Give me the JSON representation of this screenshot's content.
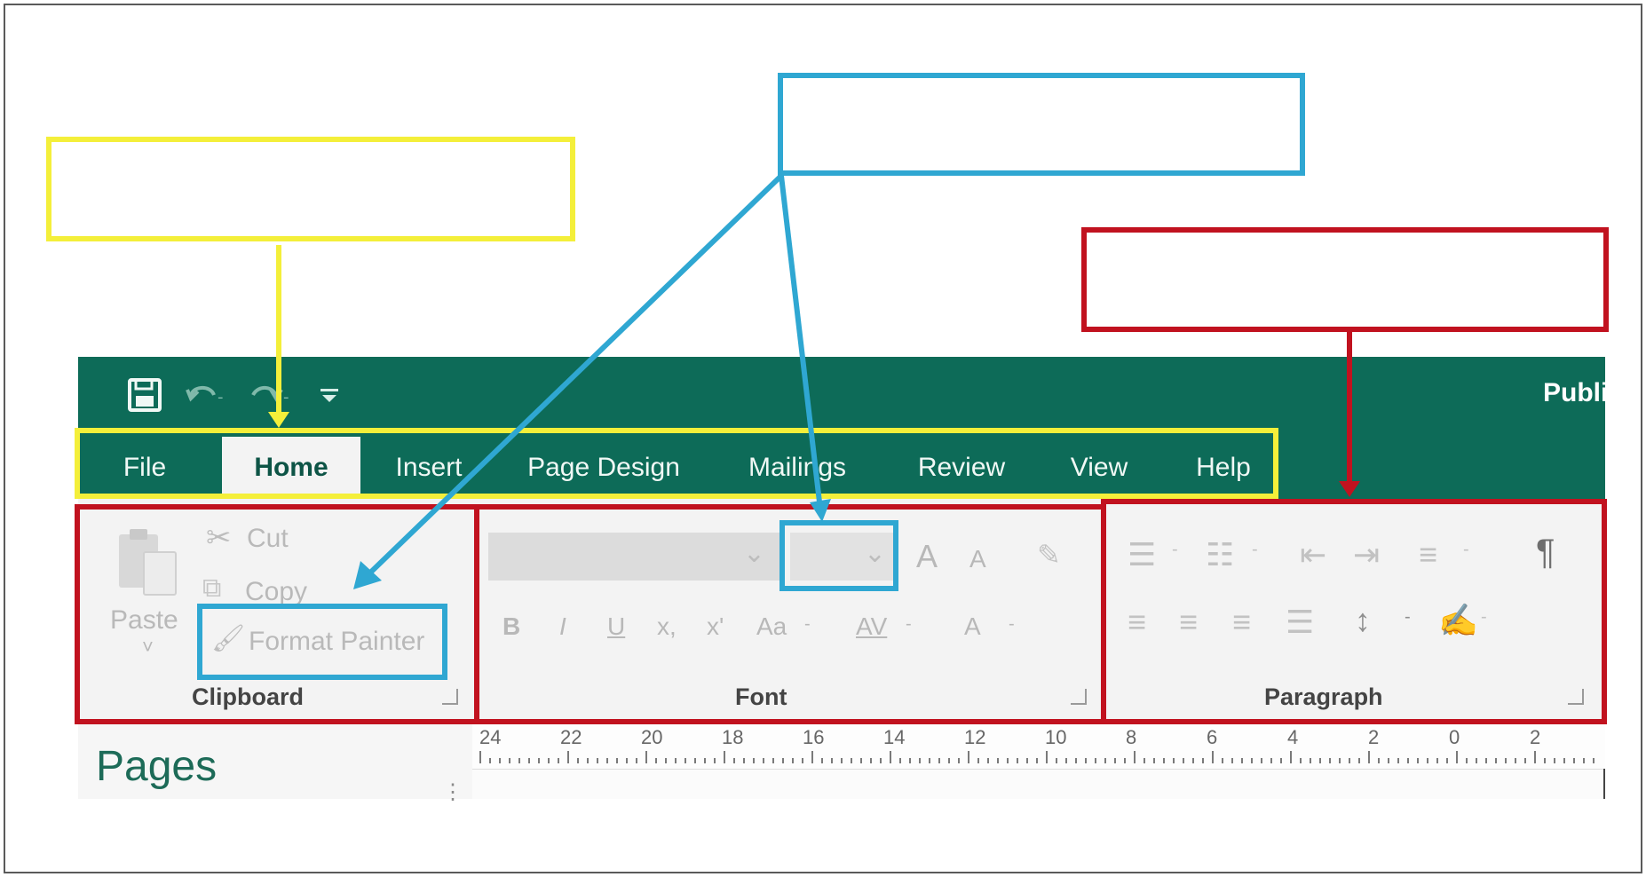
{
  "app": {
    "brand_partial": "Publi"
  },
  "quick_access": {
    "save_icon": "save-icon",
    "undo_icon": "undo-icon",
    "redo_icon": "redo-icon",
    "customize_icon": "customize-qat-icon"
  },
  "tabs": [
    {
      "label": "File"
    },
    {
      "label": "Home"
    },
    {
      "label": "Insert"
    },
    {
      "label": "Page Design"
    },
    {
      "label": "Mailings"
    },
    {
      "label": "Review"
    },
    {
      "label": "View"
    },
    {
      "label": "Help"
    }
  ],
  "clipboard": {
    "paste_label": "Paste",
    "cut_label": "Cut",
    "copy_label": "Copy",
    "format_painter_label": "Format Painter",
    "group_label": "Clipboard"
  },
  "font": {
    "font_name_value": "",
    "font_size_value": "",
    "bold": "B",
    "italic": "I",
    "underline": "U",
    "subscript": "x,",
    "superscript": "x'",
    "change_case": "Aa",
    "spacing": "AV",
    "font_color": "A",
    "grow": "A",
    "shrink": "A",
    "group_label": "Font"
  },
  "paragraph": {
    "show_marks": "¶",
    "group_label": "Paragraph"
  },
  "navigation": {
    "pages_title": "Pages"
  },
  "ruler": {
    "numbers": [
      "24",
      "22",
      "20",
      "18",
      "16",
      "14",
      "12",
      "10",
      "8",
      "6",
      "4",
      "2",
      "0",
      "2"
    ]
  },
  "annotation_colors": {
    "yellow": "#f4ef3a",
    "blue": "#2fa7d2",
    "red": "#c1121f",
    "brand_green": "#0d6b58"
  }
}
